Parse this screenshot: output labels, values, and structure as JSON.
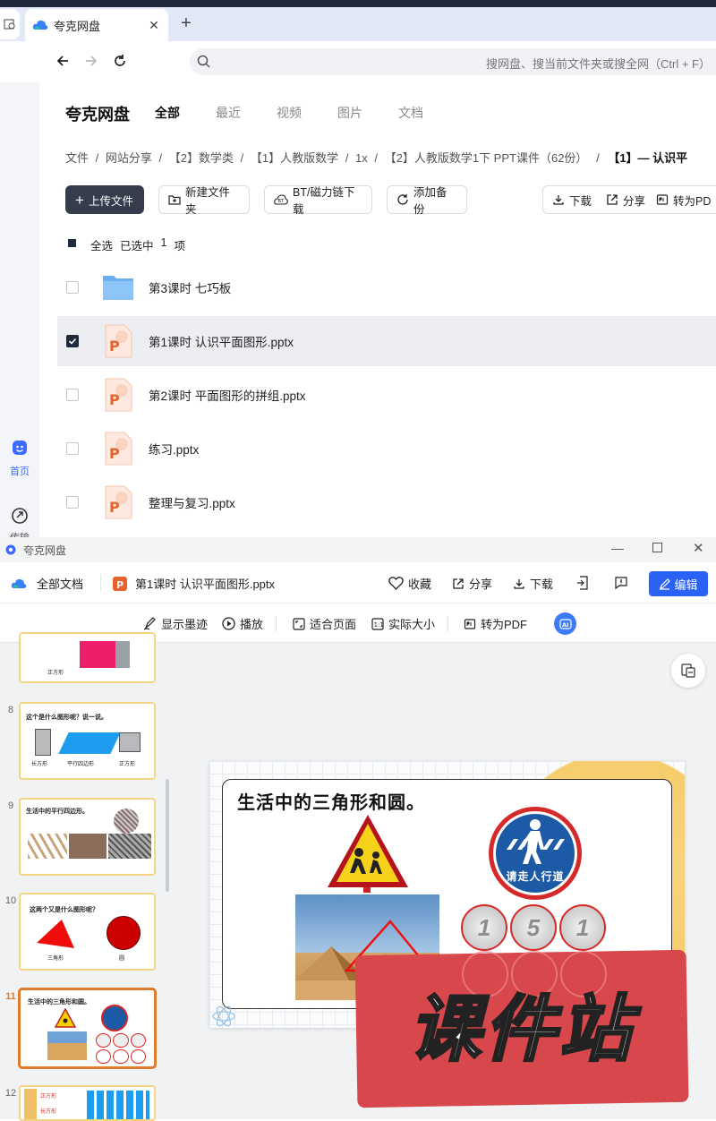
{
  "browser": {
    "tab_title": "夸克网盘",
    "address_placeholder": "搜网盘、搜当前文件夹或搜全网（Ctrl + F）"
  },
  "sidebar": {
    "home_label": "首页",
    "transfer_label": "传输"
  },
  "main": {
    "logo": "夸克网盘",
    "tabs": [
      {
        "label": "全部",
        "active": true
      },
      {
        "label": "最近"
      },
      {
        "label": "视频"
      },
      {
        "label": "图片"
      },
      {
        "label": "文档"
      }
    ],
    "breadcrumb": [
      "文件",
      "网站分享",
      "【2】数学类",
      "【1】人教版数学",
      "1x",
      "【2】人教版数学1下 PPT课件（62份）",
      "【1】— 认识平"
    ],
    "breadcrumb_sep": "/",
    "actions": {
      "upload": "上传文件",
      "new_folder": "新建文件夹",
      "bt_download": "BT/磁力链下载",
      "add_backup": "添加备份",
      "download": "下载",
      "share": "分享",
      "to_pdf": "转为PD"
    },
    "selection": {
      "select_all": "全选",
      "selected_text": "已选中",
      "count": "1",
      "unit": "项"
    },
    "files": [
      {
        "name": "第3课时 七巧板",
        "type": "folder",
        "checked": false
      },
      {
        "name": "第1课时 认识平面图形.pptx",
        "type": "pptx",
        "checked": true
      },
      {
        "name": "第2课时 平面图形的拼组.pptx",
        "type": "pptx",
        "checked": false
      },
      {
        "name": "练习.pptx",
        "type": "pptx",
        "checked": false
      },
      {
        "name": "整理与复习.pptx",
        "type": "pptx",
        "checked": false
      }
    ]
  },
  "viewer": {
    "window_title": "夸克网盘",
    "all_docs": "全部文档",
    "file_name": "第1课时 认识平面图形.pptx",
    "favorite": "收藏",
    "share": "分享",
    "download": "下载",
    "edit": "编辑",
    "toolbar": {
      "show_ink": "显示墨迹",
      "play": "播放",
      "fit_page": "适合页面",
      "actual_size": "实际大小",
      "to_pdf": "转为PDF"
    },
    "thumbnails": [
      {
        "num": "",
        "caption": "正方形"
      },
      {
        "num": "8",
        "title": "这个是什么图形呢？说一说。",
        "labels": [
          "长方形",
          "平行四边形",
          "正方形"
        ]
      },
      {
        "num": "9",
        "title": "生活中的平行四边形。"
      },
      {
        "num": "10",
        "title": "这两个又是什么图形呢？",
        "labels": [
          "三角形",
          "圆"
        ]
      },
      {
        "num": "11",
        "title": "生活中的三角形和圆。",
        "active": true
      },
      {
        "num": "12",
        "labels": [
          "正方形",
          "长方形"
        ]
      }
    ],
    "slide": {
      "title": "生活中的三角形和圆。",
      "sign_text": "请走人行道",
      "coin_values": [
        "1",
        "5",
        "1"
      ]
    },
    "watermark": "课件站",
    "accent_color": "#2b62f6",
    "ppt_color": "#e8632b"
  }
}
